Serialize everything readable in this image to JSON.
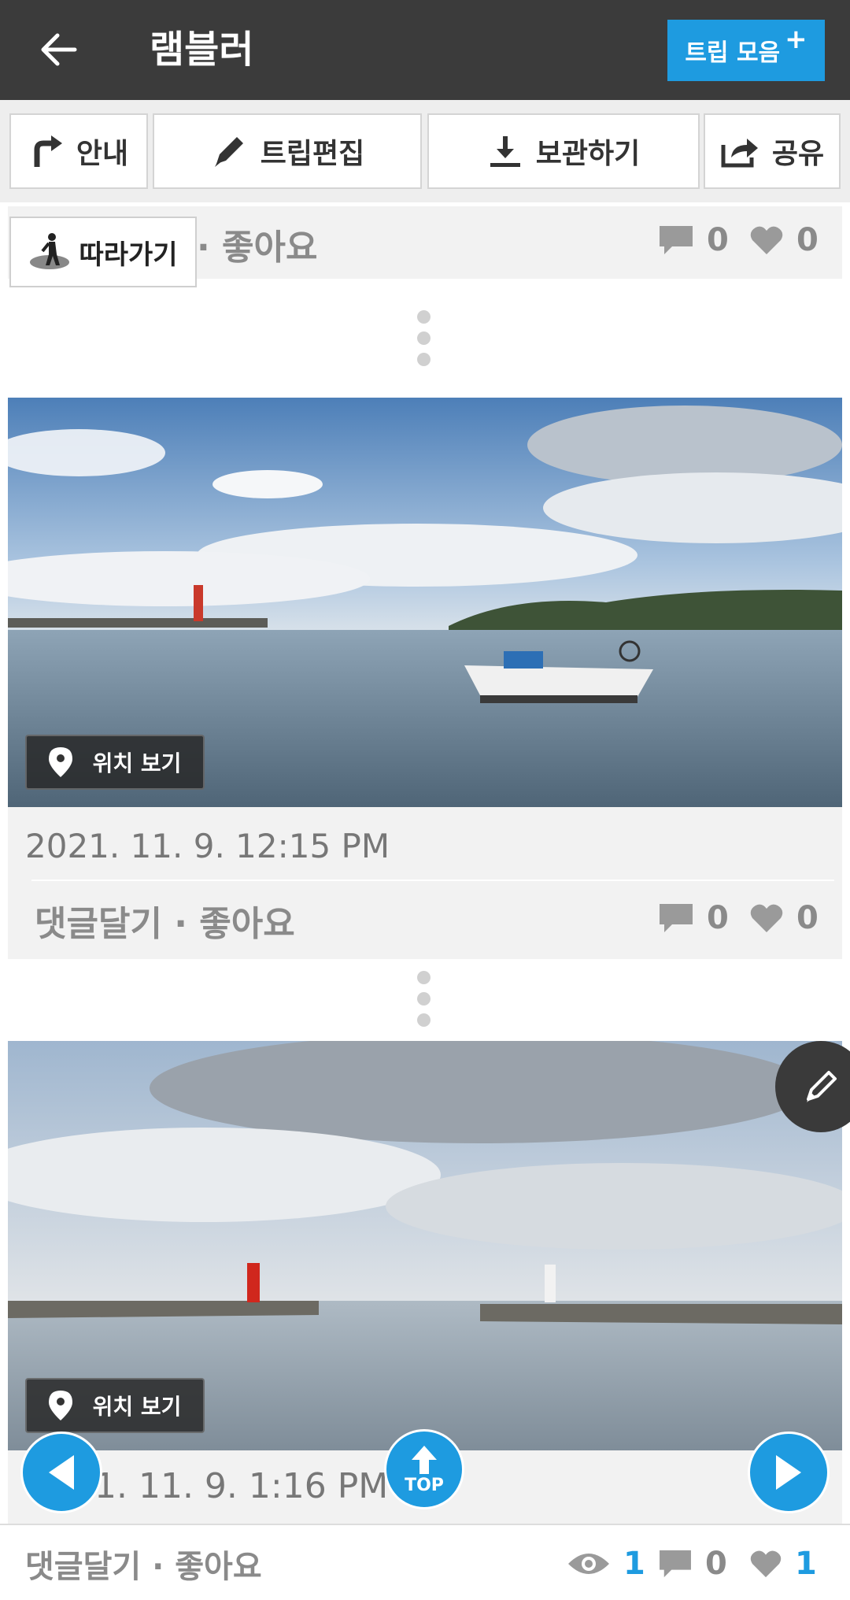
{
  "header": {
    "title": "램블러",
    "collect_label": "트립 모음",
    "collect_plus": "+"
  },
  "toolbar": {
    "guide_label": "안내",
    "edit_label": "트립편집",
    "save_label": "보관하기",
    "share_label": "공유"
  },
  "follow": {
    "label": "따라가기"
  },
  "card_top": {
    "actions": "· 좋아요",
    "comments": "0",
    "likes": "0"
  },
  "card1": {
    "location_label": "위치 보기",
    "date": "2021. 11. 9. 12:15 PM",
    "actions": "댓글달기 · 좋아요",
    "comments": "0",
    "likes": "0"
  },
  "card2": {
    "location_label": "위치 보기",
    "date": "1. 11. 9. 1:16 PM",
    "actions": "댓글달기 · 좋아요",
    "views": "1",
    "comments": "0",
    "likes": "1"
  },
  "floating": {
    "top_label": "TOP"
  },
  "colors": {
    "header_bg": "#3b3b3b",
    "accent": "#1e9be0",
    "muted_text": "#8a8a8a"
  }
}
